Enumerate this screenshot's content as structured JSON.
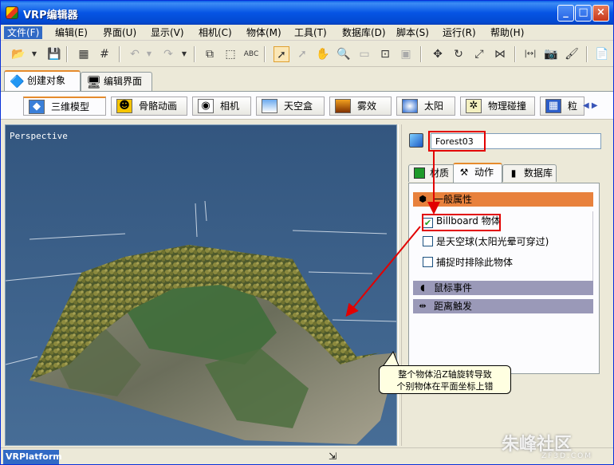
{
  "window": {
    "title": "VRP编辑器"
  },
  "menu": [
    {
      "label": "文件(F)"
    },
    {
      "label": "编辑(E)"
    },
    {
      "label": "界面(U)"
    },
    {
      "label": "显示(V)"
    },
    {
      "label": "相机(C)"
    },
    {
      "label": "物体(M)"
    },
    {
      "label": "工具(T)"
    },
    {
      "label": "数据库(D)"
    },
    {
      "label": "脚本(S)"
    },
    {
      "label": "运行(R)"
    },
    {
      "label": "帮助(H)"
    }
  ],
  "top_tabs": [
    {
      "label": "创建对象"
    },
    {
      "label": "编辑界面"
    }
  ],
  "category_tabs": [
    {
      "label": "三维模型"
    },
    {
      "label": "骨骼动画"
    },
    {
      "label": "相机"
    },
    {
      "label": "天空盒"
    },
    {
      "label": "雾效"
    },
    {
      "label": "太阳"
    },
    {
      "label": "物理碰撞"
    },
    {
      "label": "粒"
    }
  ],
  "viewport": {
    "label": "Perspective"
  },
  "object": {
    "name": "Forest03"
  },
  "prop_tabs": [
    {
      "label": "材质"
    },
    {
      "label": "动作"
    },
    {
      "label": "数据库"
    }
  ],
  "sections": {
    "general": "一般属性",
    "mouse": "鼠标事件",
    "distance": "距离触发"
  },
  "options": [
    {
      "label": "Billboard 物体",
      "checked": true
    },
    {
      "label": "是天空球(太阳光晕可穿过)",
      "checked": false
    },
    {
      "label": "捕捉时排除此物体",
      "checked": false
    }
  ],
  "callout": {
    "line1": "整个物体沿Z轴旋转导致",
    "line2": "个别物体在平面坐标上错"
  },
  "status": {
    "left": "VRPlatform"
  },
  "watermark": {
    "main": "朱峰社区",
    "sub": "ZF3D.COM"
  },
  "colors": {
    "accent": "#e8813c",
    "annotation": "#e20000",
    "selection": "#316ac5"
  }
}
